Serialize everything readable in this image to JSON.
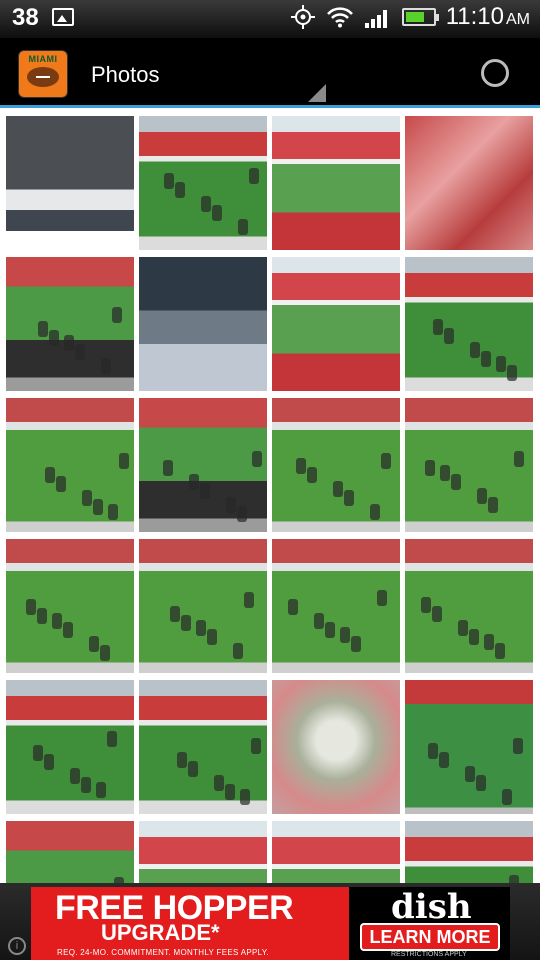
{
  "status_bar": {
    "notification_count": "38",
    "time": "11:10",
    "ampm": "AM",
    "icons": [
      "picture-icon",
      "gps-icon",
      "wifi-icon",
      "signal-icon",
      "battery-icon"
    ]
  },
  "action_bar": {
    "title": "Photos",
    "app_icon_text": "MIAMI"
  },
  "photo_grid": {
    "columns": 4,
    "photos": [
      {
        "kind": "scoreboard"
      },
      {
        "kind": "field"
      },
      {
        "kind": "stadium"
      },
      {
        "kind": "crowd"
      },
      {
        "kind": "band"
      },
      {
        "kind": "blur"
      },
      {
        "kind": "stadium"
      },
      {
        "kind": "field"
      },
      {
        "kind": "play"
      },
      {
        "kind": "band"
      },
      {
        "kind": "play"
      },
      {
        "kind": "play"
      },
      {
        "kind": "play"
      },
      {
        "kind": "play"
      },
      {
        "kind": "play"
      },
      {
        "kind": "play"
      },
      {
        "kind": "field"
      },
      {
        "kind": "field"
      },
      {
        "kind": "fog"
      },
      {
        "kind": "banner"
      },
      {
        "kind": "band"
      },
      {
        "kind": "stadium"
      },
      {
        "kind": "stadium"
      },
      {
        "kind": "field"
      }
    ]
  },
  "ad": {
    "headline": "FREE HOPPER",
    "subheadline": "UPGRADE*",
    "fine_print": "REQ. 24-MO. COMMITMENT. MONTHLY FEES APPLY.",
    "brand": "dish",
    "cta": "LEARN MORE",
    "restrictions": "RESTRICTIONS APPLY"
  },
  "colors": {
    "accent": "#3aa0d8",
    "ad_red": "#e31d1d",
    "app_orange": "#f07a1a"
  }
}
